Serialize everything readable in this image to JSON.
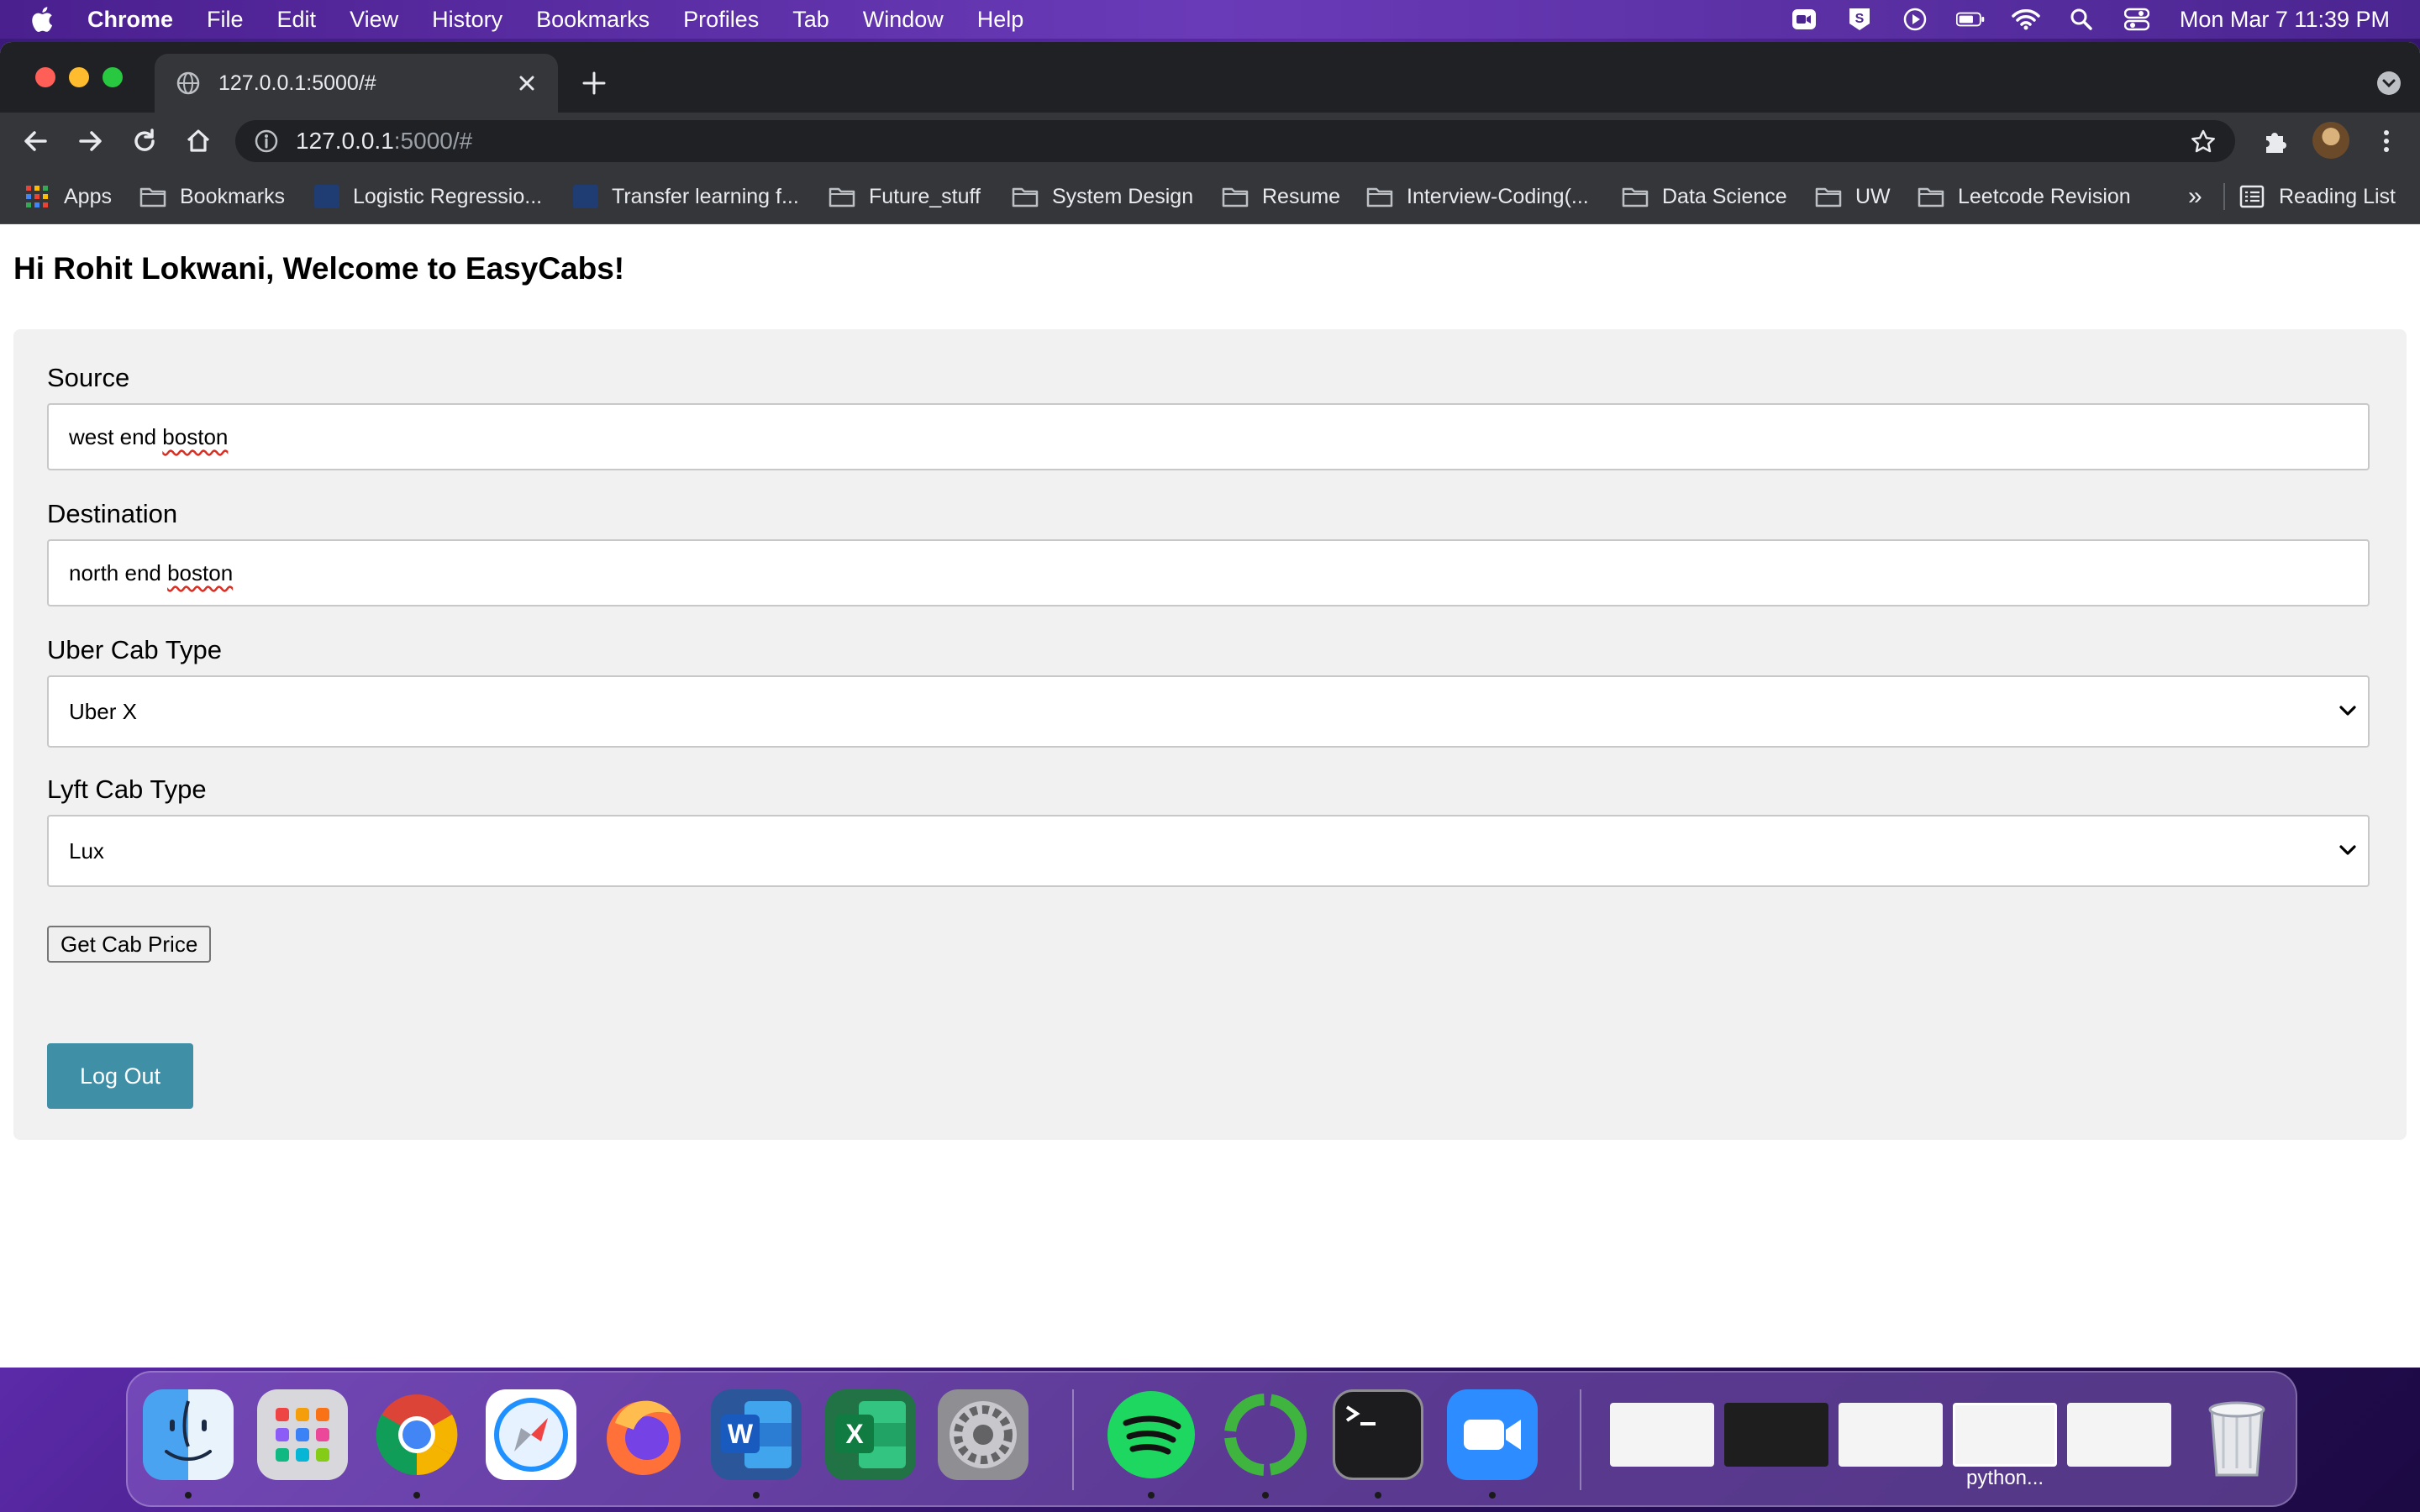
{
  "menubar": {
    "app_name": "Chrome",
    "items": [
      "File",
      "Edit",
      "View",
      "History",
      "Bookmarks",
      "Profiles",
      "Tab",
      "Window",
      "Help"
    ],
    "clock": "Mon Mar 7  11:39 PM"
  },
  "browser": {
    "tab_title": "127.0.0.1:5000/#",
    "url_host": "127.0.0.1",
    "url_rest": ":5000/#",
    "bookmarks": [
      {
        "label": "Apps",
        "icon": "apps-grid-icon"
      },
      {
        "label": "Bookmarks",
        "icon": "folder-icon"
      },
      {
        "label": "Logistic Regressio...",
        "icon": "page-thumbnail-icon"
      },
      {
        "label": "Transfer learning f...",
        "icon": "page-thumbnail-icon"
      },
      {
        "label": "Future_stuff",
        "icon": "folder-icon"
      },
      {
        "label": "System Design",
        "icon": "folder-icon"
      },
      {
        "label": "Resume",
        "icon": "folder-icon"
      },
      {
        "label": "Interview-Coding(...",
        "icon": "folder-icon"
      },
      {
        "label": "Data Science",
        "icon": "folder-icon"
      },
      {
        "label": "UW",
        "icon": "folder-icon"
      },
      {
        "label": "Leetcode Revision",
        "icon": "folder-icon"
      }
    ],
    "bookmarks_overflow": "»",
    "reading_list": "Reading List"
  },
  "page": {
    "greeting": "Hi Rohit Lokwani, Welcome to EasyCabs!",
    "source": {
      "label": "Source",
      "value_plain": "west end ",
      "value_flagged": "boston"
    },
    "destination": {
      "label": "Destination",
      "value_plain": "north end ",
      "value_flagged": "boston"
    },
    "uber": {
      "label": "Uber Cab Type",
      "selected": "Uber X"
    },
    "lyft": {
      "label": "Lyft Cab Type",
      "selected": "Lux"
    },
    "price_button": "Get Cab Price",
    "logout_button": "Log Out"
  },
  "dock": {
    "apps": [
      "Finder",
      "Launchpad",
      "Chrome",
      "Safari",
      "Firefox",
      "Word",
      "Excel",
      "System Preferences",
      "Spotify",
      "Loading",
      "Terminal",
      "Zoom"
    ],
    "minimized_window_label": "python..."
  },
  "colors": {
    "logout_button": "#3f8fa6",
    "card_background": "#f1f1f1",
    "chrome_dark": "#35363a"
  }
}
